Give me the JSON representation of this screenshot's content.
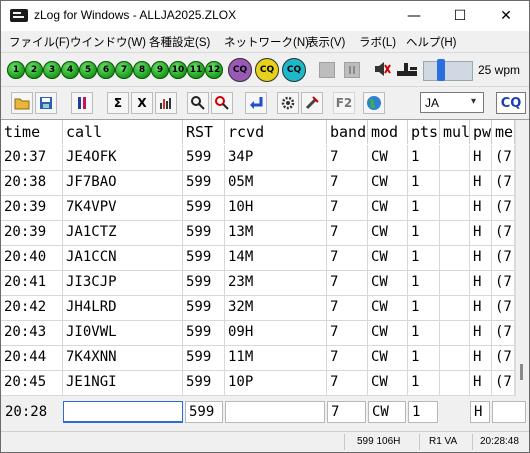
{
  "window": {
    "title": "zLog for Windows  - ALLJA2025.ZLOX",
    "minimize_glyph": "—",
    "maximize_glyph": "☐",
    "close_glyph": "✕"
  },
  "menu": [
    {
      "label": "ファイル(F)"
    },
    {
      "label": "ウインドウ(W)"
    },
    {
      "label": "各種設定(S)"
    },
    {
      "label": "ネットワーク(N)"
    },
    {
      "label": "表示(V)"
    },
    {
      "label": "ラボ(L)"
    },
    {
      "label": "ヘルプ(H)"
    }
  ],
  "toolbar1": {
    "numbers": [
      "1",
      "2",
      "3",
      "4",
      "5",
      "6",
      "7",
      "8",
      "9",
      "10",
      "11",
      "12"
    ],
    "cq_buttons": [
      "CQ",
      "CQ",
      "CQ"
    ],
    "cq_colors": [
      "#9b59b6",
      "#e6d21c",
      "#1fb8c9"
    ],
    "wpm": "25 wpm",
    "speed_fraction": 0.35
  },
  "toolbar2": {
    "icons": [
      "open-folder-icon",
      "save-icon",
      "check-partial-icon",
      "sigma-icon",
      "x-icon",
      "bar-chart-icon",
      "search-icon",
      "search-red-icon",
      "return-icon",
      "gear-icon",
      "tools-icon",
      "f2-icon",
      "globe-icon"
    ],
    "sigma_text": "Σ",
    "x_text": "X",
    "f2_text": "F2",
    "select_value": "JA",
    "cq_label": "CQ"
  },
  "grid": {
    "headers": [
      "time",
      "call",
      "RST",
      "rcvd",
      "band",
      "mod",
      "pts",
      "mul",
      "pw",
      "me"
    ],
    "rows": [
      {
        "time": "20:37",
        "call": "JE4OFK",
        "rst": "599",
        "rcvd": "34P",
        "band": "7",
        "mod": "CW",
        "pts": "1",
        "mul": "",
        "pw": "H",
        "me": "(7"
      },
      {
        "time": "20:38",
        "call": "JF7BAO",
        "rst": "599",
        "rcvd": "05M",
        "band": "7",
        "mod": "CW",
        "pts": "1",
        "mul": "",
        "pw": "H",
        "me": "(7"
      },
      {
        "time": "20:39",
        "call": "7K4VPV",
        "rst": "599",
        "rcvd": "10H",
        "band": "7",
        "mod": "CW",
        "pts": "1",
        "mul": "",
        "pw": "H",
        "me": "(7"
      },
      {
        "time": "20:39",
        "call": "JA1CTZ",
        "rst": "599",
        "rcvd": "13M",
        "band": "7",
        "mod": "CW",
        "pts": "1",
        "mul": "",
        "pw": "H",
        "me": "(7"
      },
      {
        "time": "20:40",
        "call": "JA1CCN",
        "rst": "599",
        "rcvd": "14M",
        "band": "7",
        "mod": "CW",
        "pts": "1",
        "mul": "",
        "pw": "H",
        "me": "(7"
      },
      {
        "time": "20:41",
        "call": "JI3CJP",
        "rst": "599",
        "rcvd": "23M",
        "band": "7",
        "mod": "CW",
        "pts": "1",
        "mul": "",
        "pw": "H",
        "me": "(7"
      },
      {
        "time": "20:42",
        "call": "JH4LRD",
        "rst": "599",
        "rcvd": "32M",
        "band": "7",
        "mod": "CW",
        "pts": "1",
        "mul": "",
        "pw": "H",
        "me": "(7"
      },
      {
        "time": "20:43",
        "call": "JI0VWL",
        "rst": "599",
        "rcvd": "09H",
        "band": "7",
        "mod": "CW",
        "pts": "1",
        "mul": "",
        "pw": "H",
        "me": "(7"
      },
      {
        "time": "20:44",
        "call": "7K4XNN",
        "rst": "599",
        "rcvd": "11M",
        "band": "7",
        "mod": "CW",
        "pts": "1",
        "mul": "",
        "pw": "H",
        "me": "(7"
      },
      {
        "time": "20:45",
        "call": "JE1NGI",
        "rst": "599",
        "rcvd": "10P",
        "band": "7",
        "mod": "CW",
        "pts": "1",
        "mul": "",
        "pw": "H",
        "me": "(7"
      }
    ]
  },
  "entry": {
    "time": "20:28",
    "call": "",
    "rst": "599",
    "rcvd": "",
    "band": "7",
    "mod": "CW",
    "pts": "1",
    "pw": "H",
    "me": ""
  },
  "status": {
    "info": "599 106H",
    "rig": "R1 VA",
    "clock": "20:28:48"
  }
}
